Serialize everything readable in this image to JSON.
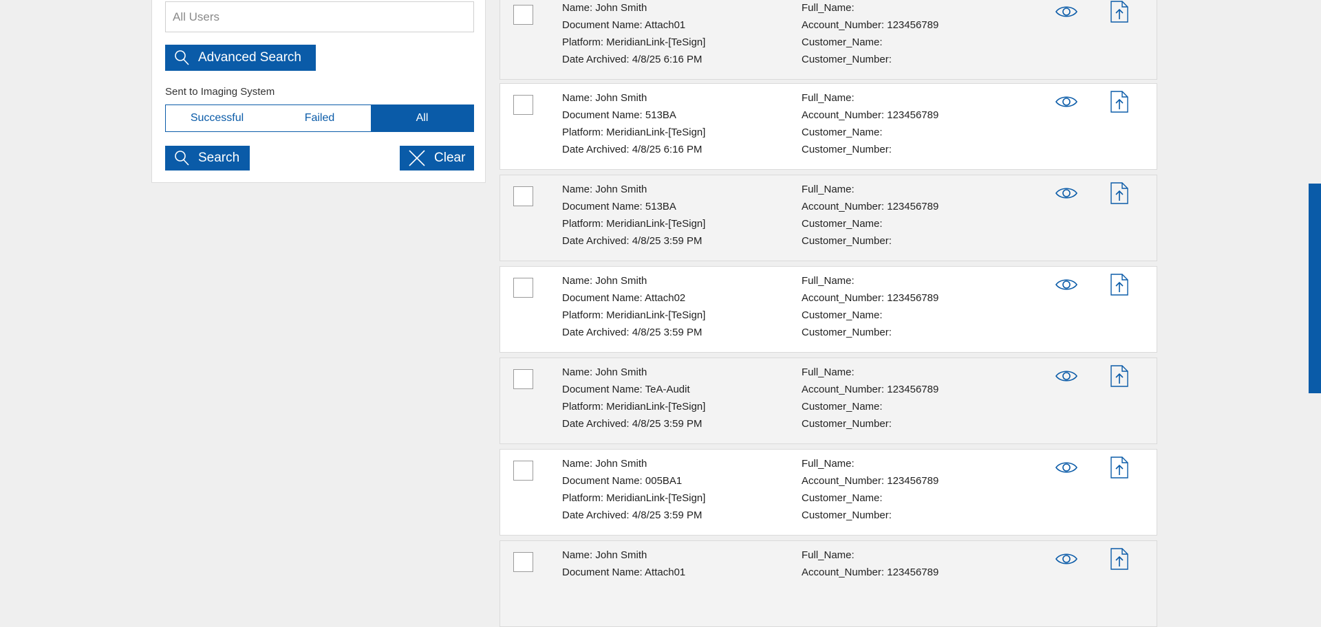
{
  "filter": {
    "user_placeholder": "All Users",
    "advanced_search_label": "Advanced Search",
    "imaging_label": "Sent to Imaging System",
    "segment_options": [
      "Successful",
      "Failed",
      "All"
    ],
    "segment_selected": "All",
    "search_label": "Search",
    "clear_label": "Clear"
  },
  "records": [
    {
      "name": "Name: John Smith",
      "document": "Document Name: Attach01",
      "platform": "Platform: MeridianLink-[TeSign]",
      "date": "Date Archived: 4/8/25 6:16 PM",
      "full_name": "Full_Name:",
      "account": "Account_Number: 123456789",
      "customer_name": "Customer_Name:",
      "customer_number": "Customer_Number:"
    },
    {
      "name": "Name: John Smith",
      "document": "Document Name: 513BA",
      "platform": "Platform: MeridianLink-[TeSign]",
      "date": "Date Archived: 4/8/25 6:16 PM",
      "full_name": "Full_Name:",
      "account": "Account_Number: 123456789",
      "customer_name": "Customer_Name:",
      "customer_number": "Customer_Number:"
    },
    {
      "name": "Name: John Smith",
      "document": "Document Name: 513BA",
      "platform": "Platform: MeridianLink-[TeSign]",
      "date": "Date Archived: 4/8/25 3:59 PM",
      "full_name": "Full_Name:",
      "account": "Account_Number: 123456789",
      "customer_name": "Customer_Name:",
      "customer_number": "Customer_Number:"
    },
    {
      "name": "Name: John Smith",
      "document": "Document Name: Attach02",
      "platform": "Platform: MeridianLink-[TeSign]",
      "date": "Date Archived: 4/8/25 3:59 PM",
      "full_name": "Full_Name:",
      "account": "Account_Number: 123456789",
      "customer_name": "Customer_Name:",
      "customer_number": "Customer_Number:"
    },
    {
      "name": "Name: John Smith",
      "document": "Document Name: TeA-Audit",
      "platform": "Platform: MeridianLink-[TeSign]",
      "date": "Date Archived: 4/8/25 3:59 PM",
      "full_name": "Full_Name:",
      "account": "Account_Number: 123456789",
      "customer_name": "Customer_Name:",
      "customer_number": "Customer_Number:"
    },
    {
      "name": "Name: John Smith",
      "document": "Document Name: 005BA1",
      "platform": "Platform: MeridianLink-[TeSign]",
      "date": "Date Archived: 4/8/25 3:59 PM",
      "full_name": "Full_Name:",
      "account": "Account_Number: 123456789",
      "customer_name": "Customer_Name:",
      "customer_number": "Customer_Number:"
    },
    {
      "name": "Name: John Smith",
      "document": "Document Name: Attach01",
      "platform": "",
      "date": "",
      "full_name": "Full_Name:",
      "account": "Account_Number: 123456789",
      "customer_name": "",
      "customer_number": ""
    }
  ],
  "icons": {
    "view": "eye-icon",
    "upload": "file-upload-icon",
    "search": "search-icon",
    "clear": "close-icon"
  },
  "colors": {
    "accent": "#0a5ba8",
    "background": "#efefef"
  }
}
